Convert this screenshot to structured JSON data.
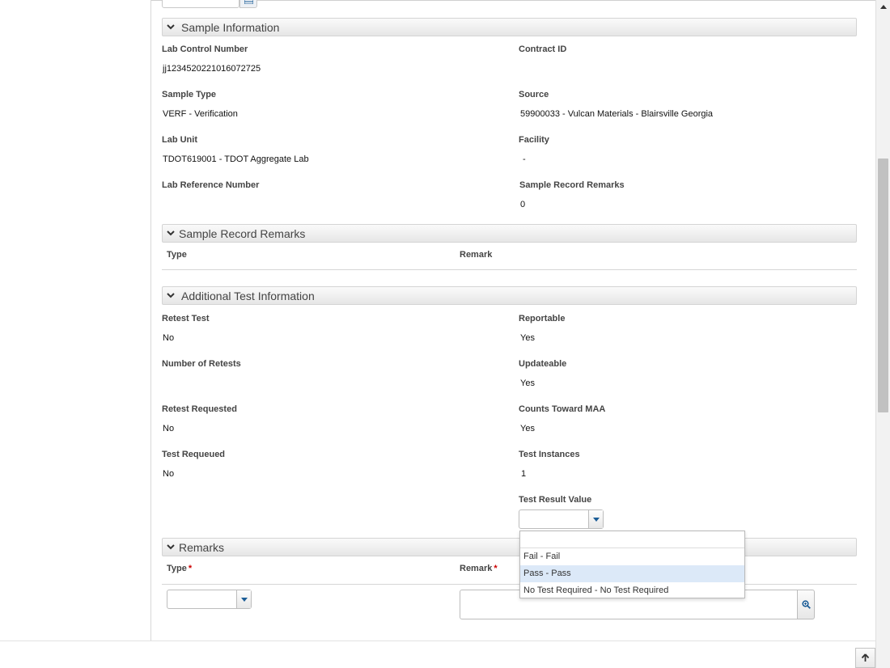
{
  "sample_information": {
    "title": "Sample Information",
    "lab_control_number_label": "Lab Control Number",
    "lab_control_number": "jj1234520221016072725",
    "contract_id_label": "Contract ID",
    "contract_id": "",
    "sample_type_label": "Sample Type",
    "sample_type": "VERF - Verification",
    "source_label": "Source",
    "source": "59900033 - Vulcan Materials - Blairsville Georgia",
    "lab_unit_label": "Lab Unit",
    "lab_unit": "TDOT619001 - TDOT Aggregate Lab",
    "facility_label": "Facility",
    "facility": "-",
    "lab_reference_number_label": "Lab Reference Number",
    "lab_reference_number": "",
    "sample_record_remarks_label": "Sample Record Remarks",
    "sample_record_remarks": "0"
  },
  "sample_record_remarks": {
    "title": "Sample Record Remarks",
    "col_type": "Type",
    "col_remark": "Remark"
  },
  "additional_test_information": {
    "title": "Additional Test Information",
    "retest_test_label": "Retest Test",
    "retest_test": "No",
    "reportable_label": "Reportable",
    "reportable": "Yes",
    "number_of_retests_label": "Number of Retests",
    "number_of_retests": "",
    "updateable_label": "Updateable",
    "updateable": "Yes",
    "retest_requested_label": "Retest Requested",
    "retest_requested": "No",
    "counts_toward_maa_label": "Counts Toward MAA",
    "counts_toward_maa": "Yes",
    "test_requeued_label": "Test Requeued",
    "test_requeued": "No",
    "test_instances_label": "Test Instances",
    "test_instances": "1",
    "test_result_value_label": "Test Result Value",
    "test_result_value": ""
  },
  "remarks": {
    "title": "Remarks",
    "col_type": "Type",
    "col_remark": "Remark",
    "required_marker": "*",
    "type_value": "",
    "remark_value": ""
  },
  "dropdown": {
    "filter_value": "",
    "options": [
      "Fail - Fail",
      "Pass - Pass",
      "No Test Required - No Test Required"
    ],
    "highlighted_index": 1
  },
  "colors": {
    "accent": "#1b5d97",
    "highlight": "#dce9f8",
    "required": "#cc0000"
  }
}
